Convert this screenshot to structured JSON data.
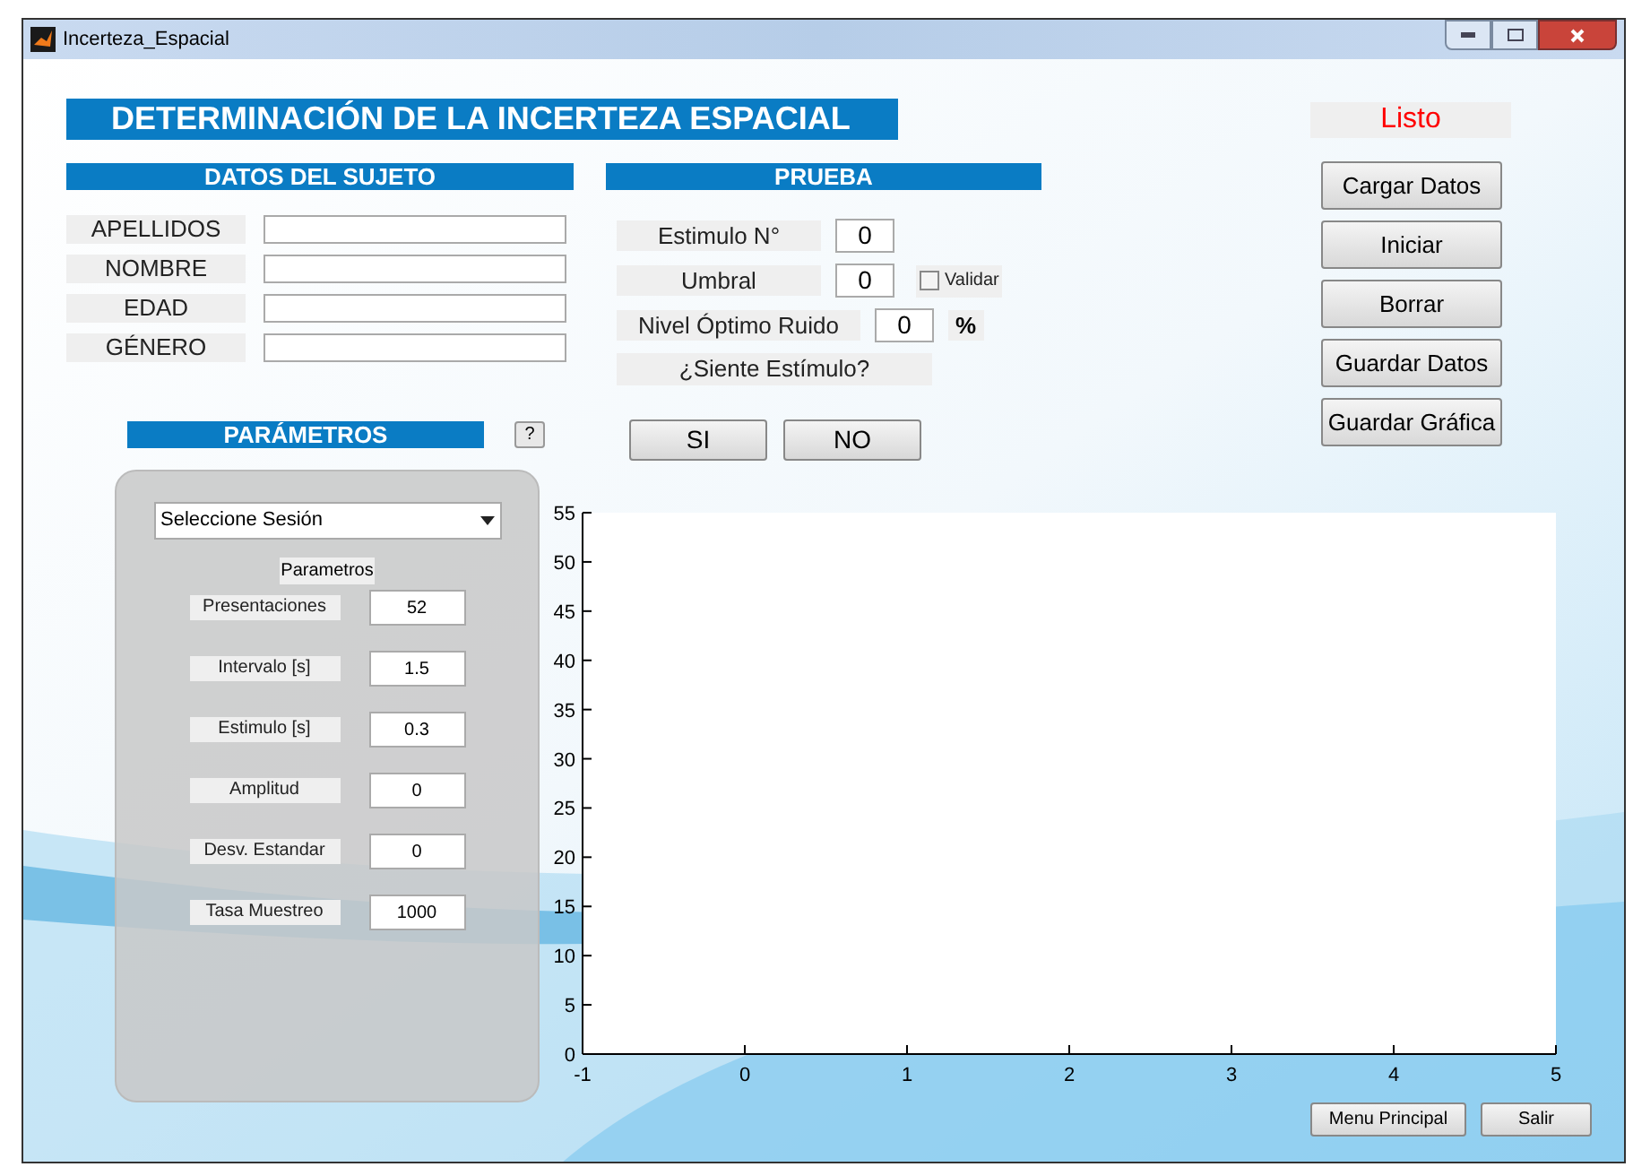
{
  "window": {
    "title": "Incerteza_Espacial"
  },
  "heading": "DETERMINACIÓN DE LA INCERTEZA ESPACIAL",
  "status": "Listo",
  "subject": {
    "header": "DATOS DEL SUJETO",
    "fields": [
      {
        "label": "APELLIDOS"
      },
      {
        "label": "NOMBRE"
      },
      {
        "label": "EDAD"
      },
      {
        "label": "GÉNERO"
      }
    ]
  },
  "test": {
    "header": "PRUEBA",
    "stimulus_no": {
      "label": "Estimulo N°",
      "value": "0"
    },
    "threshold": {
      "label": "Umbral",
      "value": "0"
    },
    "validate": {
      "label": "Validar",
      "checked": false
    },
    "noise": {
      "label": "Nivel Óptimo Ruido",
      "value": "0",
      "unit": "%"
    },
    "question": "¿Siente Estímulo?",
    "answers": [
      "SI",
      "NO"
    ]
  },
  "parameters": {
    "header": "PARÁMETROS",
    "help": "?",
    "session": {
      "value": "Seleccione Sesión"
    },
    "subheader": "Parametros",
    "fields": [
      {
        "label": "Presentaciones",
        "value": "52"
      },
      {
        "label": "Intervalo [s]",
        "value": "1.5"
      },
      {
        "label": "Estimulo [s]",
        "value": "0.3"
      },
      {
        "label": "Amplitud",
        "value": "0"
      },
      {
        "label": "Desv. Estandar",
        "value": "0"
      },
      {
        "label": "Tasa Muestreo",
        "value": "1000"
      }
    ]
  },
  "actions": [
    "Cargar Datos",
    "Iniciar",
    "Borrar",
    "Guardar Datos",
    "Guardar Gráfica"
  ],
  "chart": {
    "chart_data": {
      "type": "line",
      "xlim": [
        -1,
        5
      ],
      "ylim": [
        0,
        55
      ],
      "xticks": [
        -1,
        0,
        1,
        2,
        3,
        4,
        5
      ],
      "yticks": [
        0,
        5,
        10,
        15,
        20,
        25,
        30,
        35,
        40,
        45,
        50,
        55
      ]
    }
  },
  "footer_buttons": [
    "Menu Principal",
    "Salir"
  ]
}
